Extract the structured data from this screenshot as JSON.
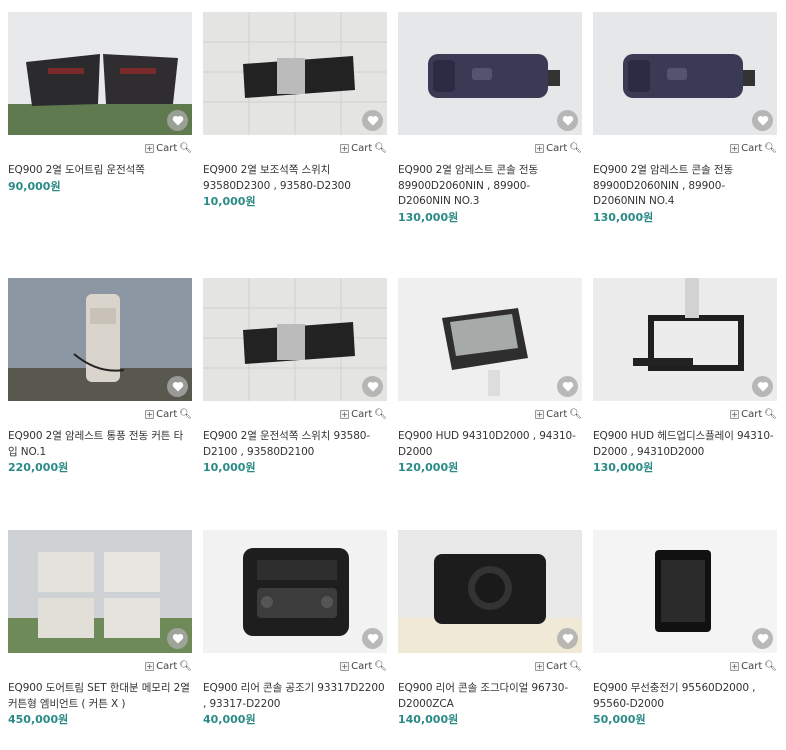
{
  "cart_label": "Cart",
  "currency": "원",
  "products": [
    {
      "title": "EQ900 2열 도어트림 운전석쪽",
      "price": "90,000원",
      "image": "door-trim-pair"
    },
    {
      "title": "EQ900 2열 보조석쪽 스위치 93580D2300 , 93580-D2300",
      "price": "10,000원",
      "image": "seat-switch"
    },
    {
      "title": "EQ900 2열 암레스트 콘솔 전동 89900D2060NIN , 89900-D2060NIN NO.3",
      "price": "130,000원",
      "image": "armrest-console"
    },
    {
      "title": "EQ900 2열 암레스트 콘솔 전동 89900D2060NIN , 89900-D2060NIN NO.4",
      "price": "130,000원",
      "image": "armrest-console"
    },
    {
      "title": "EQ900 2열 암레스트 통풍 전동 커튼 타입 NO.1",
      "price": "220,000원",
      "image": "armrest-curtain"
    },
    {
      "title": "EQ900 2열 운전석쪽 스위치 93580-D2100 , 93580D2100",
      "price": "10,000원",
      "image": "seat-switch"
    },
    {
      "title": "EQ900 HUD 94310D2000 , 94310-D2000",
      "price": "120,000원",
      "image": "hud-unit"
    },
    {
      "title": "EQ900 HUD 헤드업디스플레이 94310-D2000 , 94310D2000",
      "price": "130,000원",
      "image": "hud-frame"
    },
    {
      "title": "EQ900 도어트림 SET 한대분 메모리 2열커튼형 엠비언트 ( 커튼 X )",
      "price": "450,000원",
      "image": "door-trim-set"
    },
    {
      "title": "EQ900 리어 콘솔 공조기 93317D2200 , 93317-D2200",
      "price": "40,000원",
      "image": "climate-control"
    },
    {
      "title": "EQ900 리어 콘솔 조그다이얼 96730-D2000ZCA",
      "price": "140,000원",
      "image": "jog-dial"
    },
    {
      "title": "EQ900 무선충전기 95560D2000 , 95560-D2000",
      "price": "50,000원",
      "image": "wireless-charger"
    }
  ]
}
